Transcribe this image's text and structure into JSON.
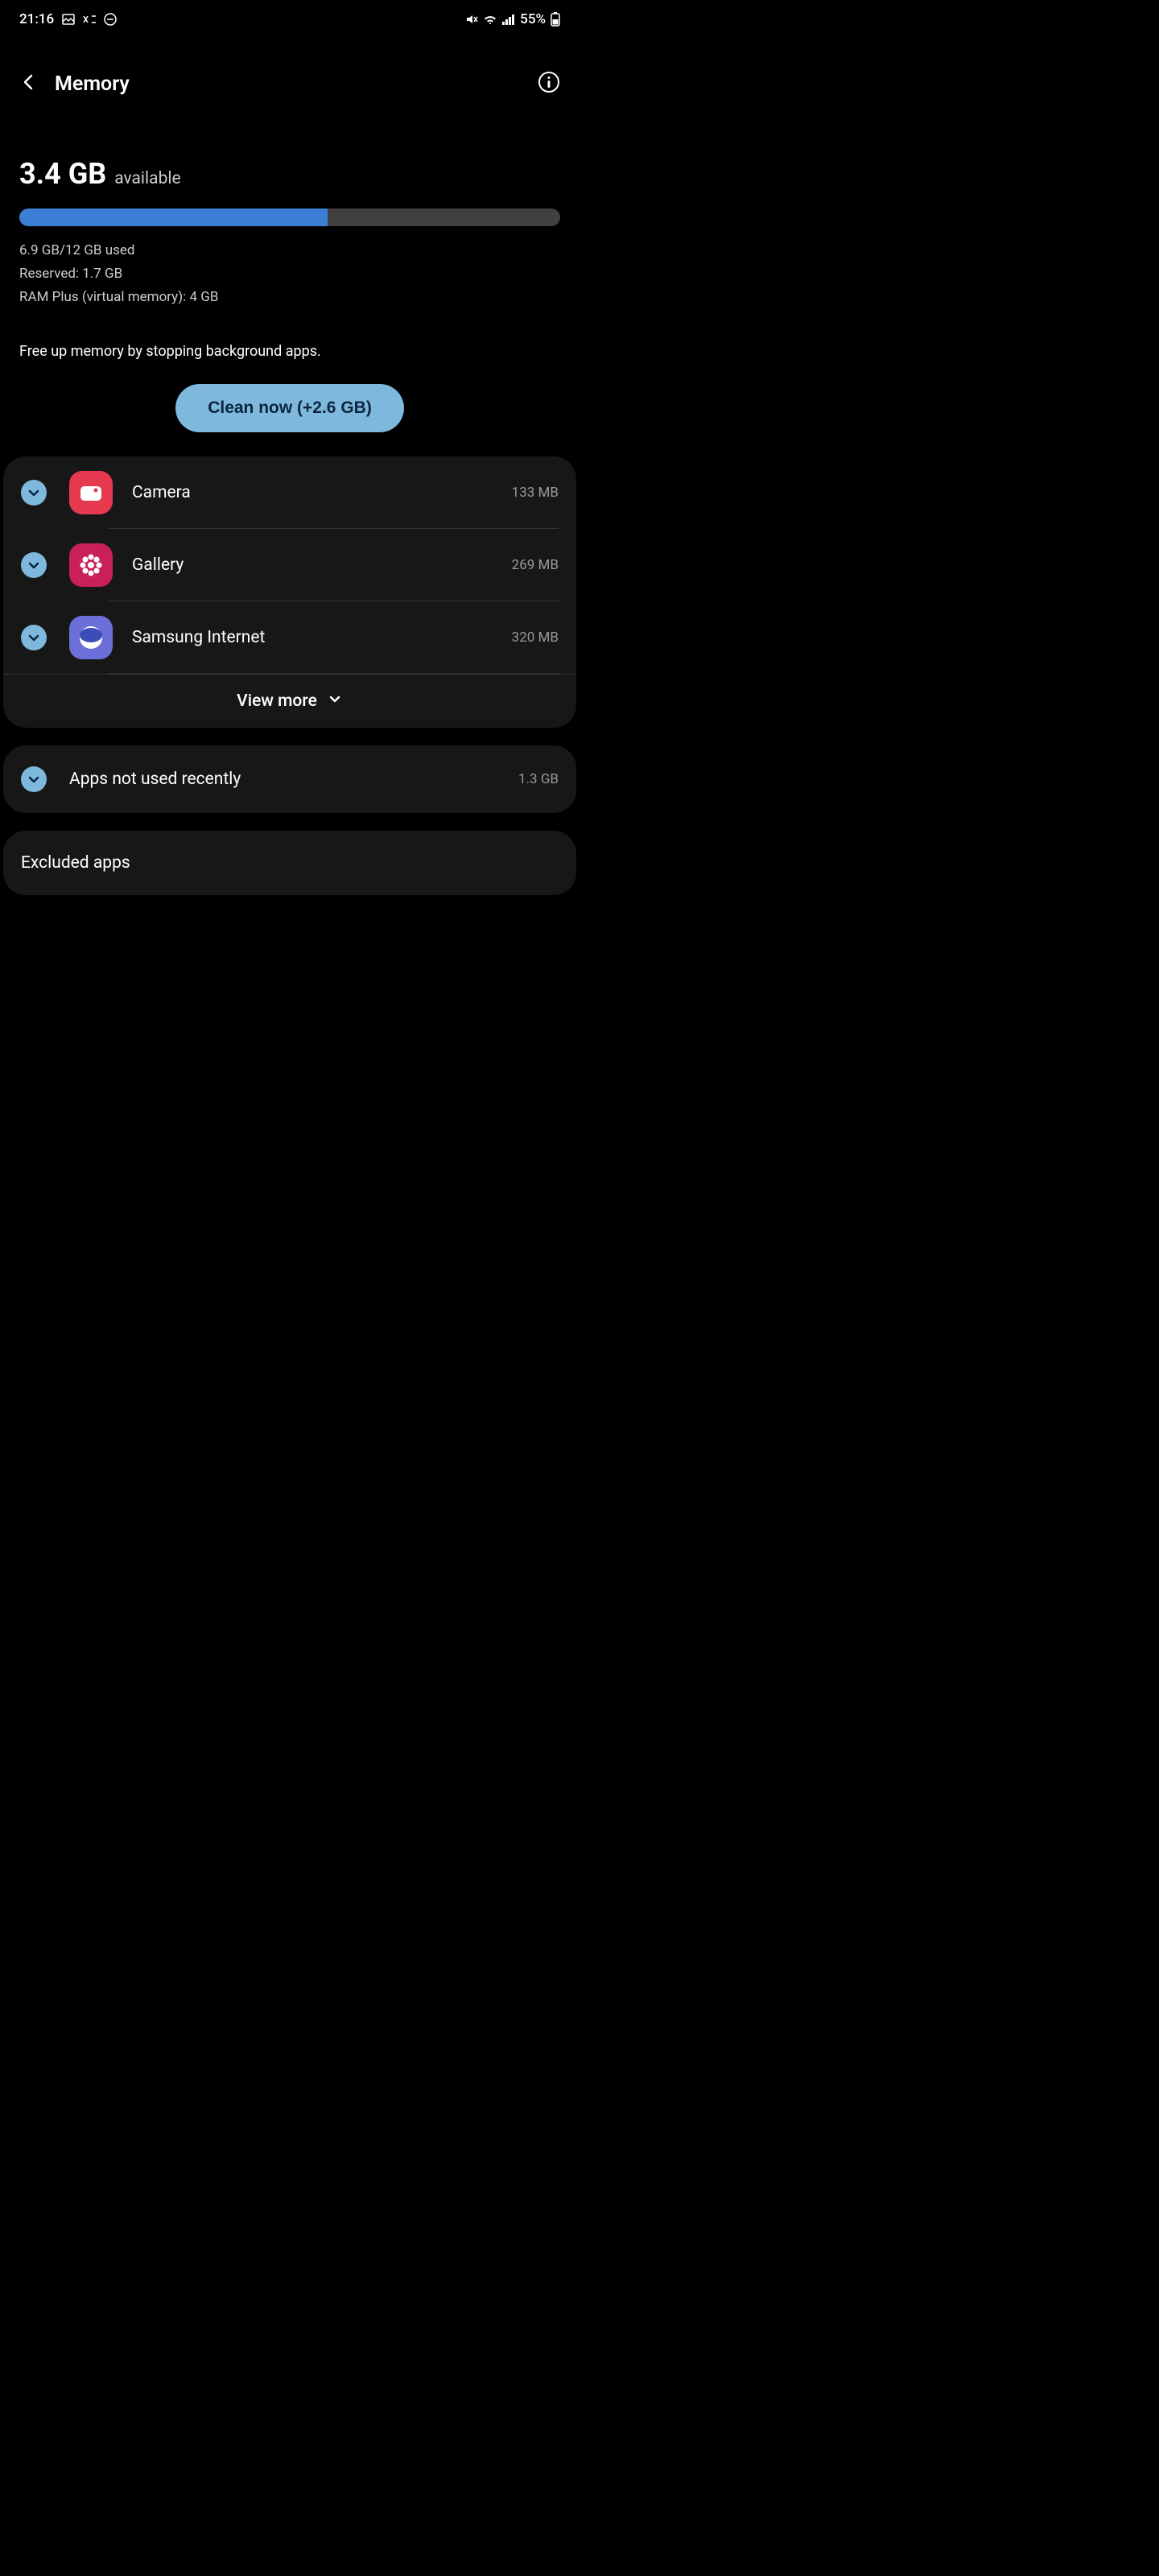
{
  "status_bar": {
    "time": "21:16",
    "battery": "55%"
  },
  "header": {
    "title": "Memory"
  },
  "memory": {
    "available_value": "3.4 GB",
    "available_label": "available",
    "usage_percent": 57,
    "used_line": "6.9 GB/12 GB used",
    "reserved_line": "Reserved: 1.7 GB",
    "ram_plus_line": "RAM Plus (virtual memory): 4 GB"
  },
  "free_up_text": "Free up memory by stopping background apps.",
  "clean_button": "Clean now (+2.6 GB)",
  "apps": [
    {
      "name": "Camera",
      "size": "133 MB",
      "checked": true
    },
    {
      "name": "Gallery",
      "size": "269 MB",
      "checked": true
    },
    {
      "name": "Samsung Internet",
      "size": "320 MB",
      "checked": true
    }
  ],
  "view_more": "View more",
  "not_used": {
    "label": "Apps not used recently",
    "size": "1.3 GB",
    "checked": true
  },
  "excluded": {
    "label": "Excluded apps"
  }
}
